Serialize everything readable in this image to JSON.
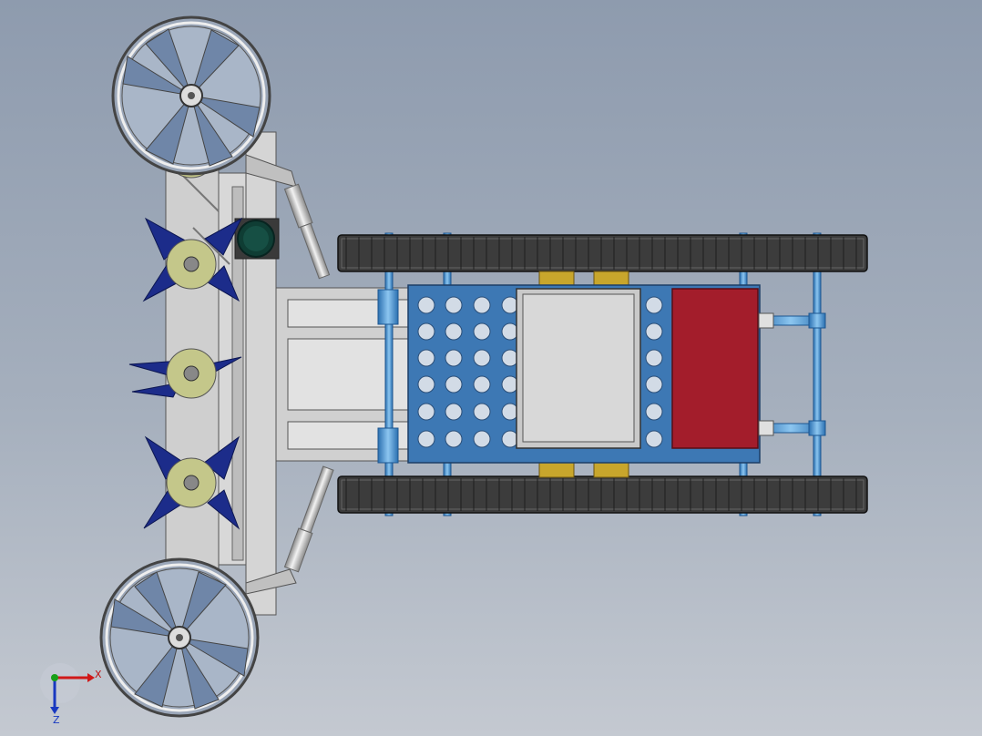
{
  "viewport": {
    "background_top": "#8e9bae",
    "background_bottom": "#c4c9d1"
  },
  "triad": {
    "x_label": "X",
    "z_label": "Z",
    "x_color": "#d01818",
    "y_color": "#18a018",
    "z_color": "#1838c0"
  },
  "colors": {
    "track": "#3c3c3c",
    "chassis_plate": "#3d78b4",
    "axle": "#3d8ed0",
    "battery_box": "#a31d2b",
    "bearing": "#c8a62c",
    "paddle_blade": "#1c2c8a",
    "roller": "#c4c78a",
    "steel": "#c8c8c8",
    "motor": "#0f3d34"
  }
}
